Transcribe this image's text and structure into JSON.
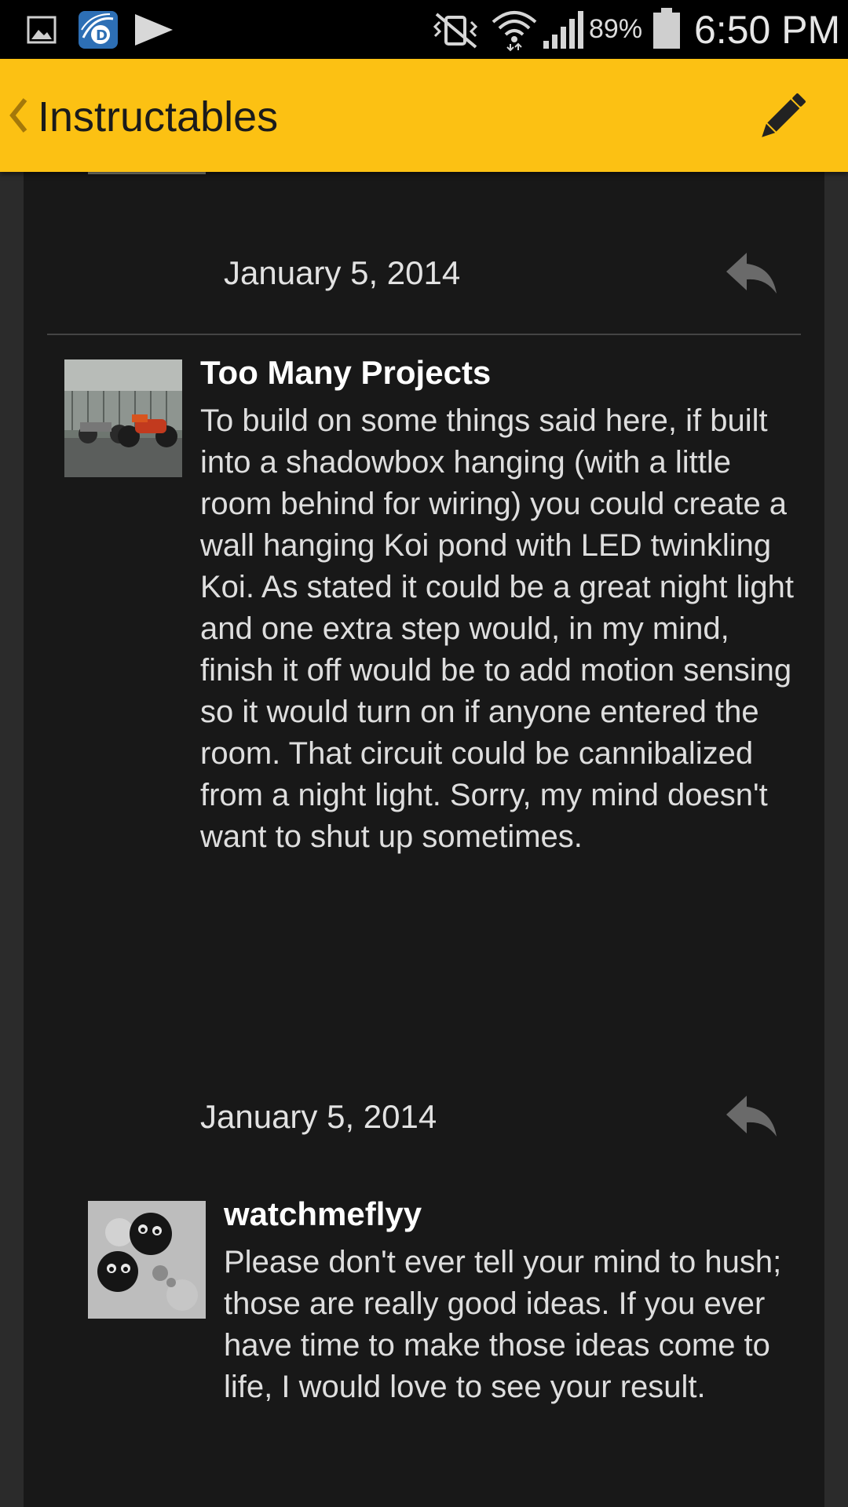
{
  "status_bar": {
    "battery_percent": "89%",
    "time": "6:50 PM",
    "icons": [
      "gallery-icon",
      "d-app-icon",
      "play-store-icon",
      "vibrate-mute-icon",
      "wifi-icon",
      "signal-icon",
      "battery-icon"
    ]
  },
  "app_bar": {
    "title": "Instructables",
    "back_icon": "chevron-left-icon",
    "action_icon": "pencil-icon",
    "accent_color": "#fcc113"
  },
  "comments": [
    {
      "date": "January 5, 2014",
      "author": "Too Many Projects",
      "avatar": "motorcycle-photo",
      "body": "To build on some things said here, if built into a shadowbox hanging (with a little room behind for wiring) you could create a wall hanging Koi pond with LED twinkling Koi. As stated it could be a great night light and one extra step would, in my mind, finish it off would be to add motion sensing so it would turn on if anyone entered the room. That circuit could be cannibalized from a night light. Sorry, my mind doesn't want to shut up sometimes."
    },
    {
      "date": "January 5, 2014",
      "author": "watchmeflyy",
      "avatar": "soot-sprites-drawing",
      "body": "Please don't ever tell your mind to hush; those are really good ideas. If you ever have time to make those ideas come to life, I would love to see your result."
    }
  ]
}
